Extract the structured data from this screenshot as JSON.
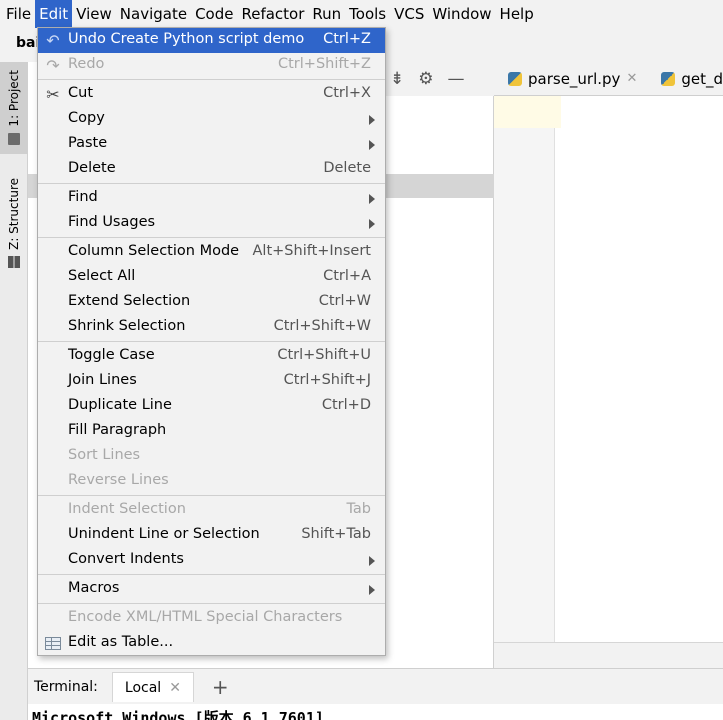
{
  "menubar": {
    "items": [
      {
        "label": "File"
      },
      {
        "label": "Edit"
      },
      {
        "label": "View"
      },
      {
        "label": "Navigate"
      },
      {
        "label": "Code"
      },
      {
        "label": "Refactor"
      },
      {
        "label": "Run"
      },
      {
        "label": "Tools"
      },
      {
        "label": "VCS"
      },
      {
        "label": "Window"
      },
      {
        "label": "Help"
      }
    ],
    "active": "Edit",
    "active_color": "#2f65ca"
  },
  "toolbar": {
    "project_name": "bai"
  },
  "left_strip": {
    "project_tab": "1: Project",
    "structure_tab": "Z: Structure"
  },
  "editor": {
    "tabs": [
      {
        "label": "parse_url.py",
        "icon": "python-file-icon"
      },
      {
        "label": "get_data",
        "icon": "python-file-icon"
      }
    ]
  },
  "terminal": {
    "label": "Terminal:",
    "tab": "Local",
    "output": "Microsoft Windows [版本 6.1.7601]"
  },
  "edit_menu": {
    "items": [
      {
        "label": "Undo Create Python script demo",
        "shortcut": "Ctrl+Z",
        "icon": "undo-icon"
      },
      {
        "label": "Redo",
        "shortcut": "Ctrl+Shift+Z",
        "icon": "redo-icon"
      },
      {
        "label": "Cut",
        "shortcut": "Ctrl+X",
        "icon": "scissors-icon"
      },
      {
        "label": "Copy"
      },
      {
        "label": "Paste"
      },
      {
        "label": "Delete",
        "shortcut": "Delete"
      },
      {
        "label": "Find"
      },
      {
        "label": "Find Usages"
      },
      {
        "label": "Column Selection Mode",
        "shortcut": "Alt+Shift+Insert"
      },
      {
        "label": "Select All",
        "shortcut": "Ctrl+A"
      },
      {
        "label": "Extend Selection",
        "shortcut": "Ctrl+W"
      },
      {
        "label": "Shrink Selection",
        "shortcut": "Ctrl+Shift+W"
      },
      {
        "label": "Toggle Case",
        "shortcut": "Ctrl+Shift+U"
      },
      {
        "label": "Join Lines",
        "shortcut": "Ctrl+Shift+J"
      },
      {
        "label": "Duplicate Line",
        "shortcut": "Ctrl+D"
      },
      {
        "label": "Fill Paragraph"
      },
      {
        "label": "Sort Lines"
      },
      {
        "label": "Reverse Lines"
      },
      {
        "label": "Indent Selection",
        "shortcut": "Tab"
      },
      {
        "label": "Unindent Line or Selection",
        "shortcut": "Shift+Tab"
      },
      {
        "label": "Convert Indents"
      },
      {
        "label": "Macros"
      },
      {
        "label": "Encode XML/HTML Special Characters"
      },
      {
        "label": "Edit as Table...",
        "icon": "table-icon"
      }
    ]
  }
}
